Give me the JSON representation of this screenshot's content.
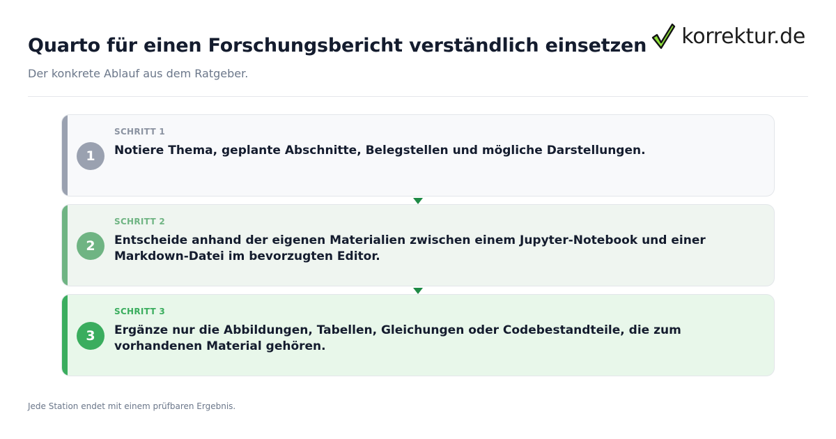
{
  "header": {
    "title": "Quarto für einen Forschungsbericht verständlich einsetzen",
    "subtitle": "Der konkrete Ablauf aus dem Ratgeber."
  },
  "logo": {
    "text": "korrektur.de",
    "icon": "checkmark-icon"
  },
  "steps": [
    {
      "number": "1",
      "label": "SCHRITT 1",
      "text": "Notiere Thema, geplante Abschnitte, Belegstellen und mögliche Darstellungen.",
      "color": "#9aa1b0"
    },
    {
      "number": "2",
      "label": "SCHRITT 2",
      "text": "Entscheide anhand der eigenen Materialien zwischen einem Jupyter-Notebook und einer Markdown-Datei im bevorzugten Editor.",
      "color": "#6fb483"
    },
    {
      "number": "3",
      "label": "SCHRITT 3",
      "text": "Ergänze nur die Abbildungen, Tabellen, Gleichungen oder Codebestandteile, die zum vorhandenen Material gehören.",
      "color": "#3aad5e"
    }
  ],
  "footer": {
    "note": "Jede Station endet mit einem prüfbaren Ergebnis."
  },
  "colors": {
    "arrow": "#1e8a45",
    "title": "#141c2e"
  }
}
